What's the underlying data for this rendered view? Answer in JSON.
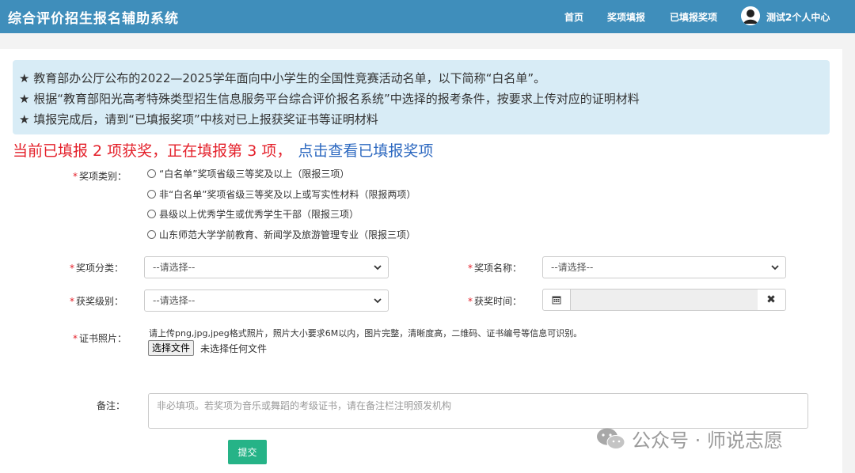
{
  "header": {
    "app_title": "综合评价招生报名辅助系统",
    "nav": [
      "首页",
      "奖项填报",
      "已填报奖项"
    ],
    "user_label": "测试2个人中心"
  },
  "notice": {
    "lines": [
      "★ 教育部办公厅公布的2022—2025学年面向中小学生的全国性竞赛活动名单，以下简称“白名单”。",
      "★ 根据“教育部阳光高考特殊类型招生信息服务平台综合评价报名系统”中选择的报考条件，按要求上传对应的证明材料",
      "★ 填报完成后，请到“已填报奖项”中核对已上报获奖证书等证明材料"
    ]
  },
  "status": {
    "text": "当前已填报 2 项获奖，正在填报第 3 项，",
    "link": "点击查看已填报奖项"
  },
  "form": {
    "required_mark": "*",
    "award_category_label": "奖项类别：",
    "award_category_options": [
      "“白名单”奖项省级三等奖及以上（限报三项）",
      "非“白名单”奖项省级三等奖及以上或写实性材料（限报两项）",
      "县级以上优秀学生或优秀学生干部（限报三项）",
      "山东师范大学学前教育、新闻学及旅游管理专业（限报三项）"
    ],
    "award_class_label": "奖项分类：",
    "award_class_value": "--请选择--",
    "award_name_label": "奖项名称：",
    "award_name_value": "--请选择--",
    "award_level_label": "获奖级别：",
    "award_level_value": "--请选择--",
    "award_time_label": "获奖时间：",
    "award_time_value": "",
    "certificate_label": "证书照片：",
    "upload_hint": "请上传png,jpg,jpeg格式照片，照片大小要求6M以内，图片完整，清晰度高，二维码、证书编号等信息可识别。",
    "file_button": "选择文件",
    "file_status": "未选择任何文件",
    "remark_label": "备注：",
    "remark_placeholder": "非必填项。若奖项为音乐或舞蹈的考级证书，请在备注栏注明颁发机构",
    "submit": "提交"
  },
  "watermark": {
    "text": "公众号 · 师说志愿"
  },
  "colors": {
    "header_bg": "#3f8ebb",
    "notice_bg": "#d8ecf6",
    "status_red": "#e4202a",
    "link_blue": "#2c68c0",
    "submit_green": "#26b387"
  }
}
